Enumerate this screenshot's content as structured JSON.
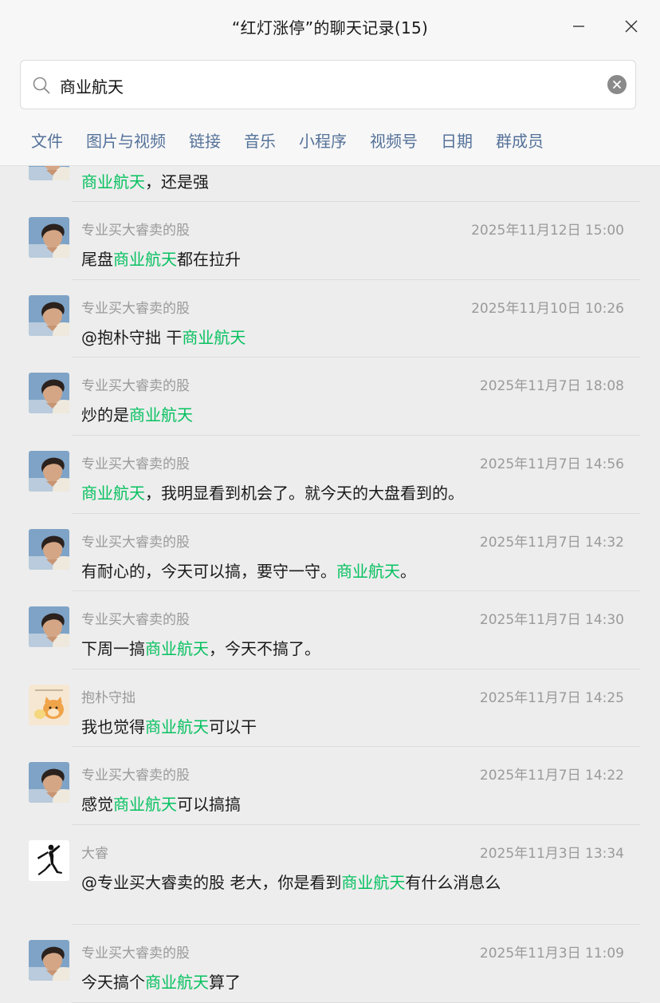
{
  "window": {
    "title": "“红灯涨停”的聊天记录(15)",
    "minimize_icon": "minimize-icon",
    "close_icon": "close-icon"
  },
  "search": {
    "value": "商业航天",
    "icon": "search-icon",
    "clear_icon": "clear-icon"
  },
  "filters": [
    "文件",
    "图片与视频",
    "链接",
    "音乐",
    "小程序",
    "视频号",
    "日期",
    "群成员"
  ],
  "colors": {
    "highlight": "#07c160",
    "filter_text": "#55729a",
    "meta_text": "#9a9a9a",
    "background": "#ededed"
  },
  "messages": [
    {
      "avatar": "boy-avatar",
      "sender": "",
      "time": "",
      "segments": [
        {
          "t": "商业航天",
          "hl": true
        },
        {
          "t": "，还是强",
          "hl": false
        }
      ]
    },
    {
      "avatar": "boy-avatar",
      "sender": "专业买大睿卖的股",
      "time": "2025年11月12日 15:00",
      "segments": [
        {
          "t": "尾盘",
          "hl": false
        },
        {
          "t": "商业航天",
          "hl": true
        },
        {
          "t": "都在拉升",
          "hl": false
        }
      ]
    },
    {
      "avatar": "boy-avatar",
      "sender": "专业买大睿卖的股",
      "time": "2025年11月10日 10:26",
      "segments": [
        {
          "t": "@抱朴守拙 干",
          "hl": false
        },
        {
          "t": "商业航天",
          "hl": true
        }
      ]
    },
    {
      "avatar": "boy-avatar",
      "sender": "专业买大睿卖的股",
      "time": "2025年11月7日 18:08",
      "segments": [
        {
          "t": "炒的是",
          "hl": false
        },
        {
          "t": "商业航天",
          "hl": true
        }
      ]
    },
    {
      "avatar": "boy-avatar",
      "sender": "专业买大睿卖的股",
      "time": "2025年11月7日 14:56",
      "segments": [
        {
          "t": "商业航天",
          "hl": true
        },
        {
          "t": "，我明显看到机会了。就今天的大盘看到的。",
          "hl": false
        }
      ]
    },
    {
      "avatar": "boy-avatar",
      "sender": "专业买大睿卖的股",
      "time": "2025年11月7日 14:32",
      "segments": [
        {
          "t": "有耐心的，今天可以搞，要守一守。",
          "hl": false
        },
        {
          "t": "商业航天",
          "hl": true
        },
        {
          "t": "。",
          "hl": false
        }
      ]
    },
    {
      "avatar": "boy-avatar",
      "sender": "专业买大睿卖的股",
      "time": "2025年11月7日 14:30",
      "segments": [
        {
          "t": "下周一搞",
          "hl": false
        },
        {
          "t": "商业航天",
          "hl": true
        },
        {
          "t": "，今天不搞了。",
          "hl": false
        }
      ]
    },
    {
      "avatar": "cartoon-cat-avatar",
      "sender": "抱朴守拙",
      "time": "2025年11月7日 14:25",
      "segments": [
        {
          "t": "我也觉得",
          "hl": false
        },
        {
          "t": "商业航天",
          "hl": true
        },
        {
          "t": "可以干",
          "hl": false
        }
      ]
    },
    {
      "avatar": "boy-avatar",
      "sender": "专业买大睿卖的股",
      "time": "2025年11月7日 14:22",
      "segments": [
        {
          "t": "感觉",
          "hl": false
        },
        {
          "t": "商业航天",
          "hl": true
        },
        {
          "t": "可以搞搞",
          "hl": false
        }
      ]
    },
    {
      "avatar": "jumpman-logo-avatar",
      "sender": "大睿",
      "time": "2025年11月3日 13:34",
      "segments": [
        {
          "t": "@专业买大睿卖的股 老大，你是看到",
          "hl": false
        },
        {
          "t": "商业航天",
          "hl": true
        },
        {
          "t": "有什么消息么",
          "hl": false
        }
      ]
    },
    {
      "avatar": "boy-avatar",
      "sender": "专业买大睿卖的股",
      "time": "2025年11月3日 11:09",
      "segments": [
        {
          "t": "今天搞个",
          "hl": false
        },
        {
          "t": "商业航天",
          "hl": true
        },
        {
          "t": "算了",
          "hl": false
        }
      ]
    }
  ]
}
